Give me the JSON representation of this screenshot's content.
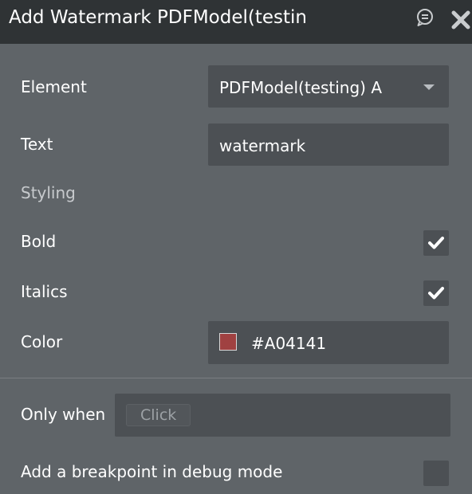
{
  "header": {
    "title": "Add Watermark PDFModel(testing)"
  },
  "fields": {
    "element": {
      "label": "Element",
      "value": "PDFModel(testing) A"
    },
    "text": {
      "label": "Text",
      "value": "watermark"
    },
    "styling": {
      "label": "Styling"
    },
    "bold": {
      "label": "Bold",
      "checked": true
    },
    "italics": {
      "label": "Italics",
      "checked": true
    },
    "color": {
      "label": "Color",
      "value": "#A04141",
      "swatch": "#A04141"
    }
  },
  "only_when": {
    "label": "Only when",
    "placeholder": "Click"
  },
  "breakpoint": {
    "label": "Add a breakpoint in debug mode",
    "checked": false
  },
  "icons": {
    "comment": "comment-icon",
    "close": "close-icon",
    "check": "checkmark-icon",
    "dropdown": "caret-down-icon"
  }
}
